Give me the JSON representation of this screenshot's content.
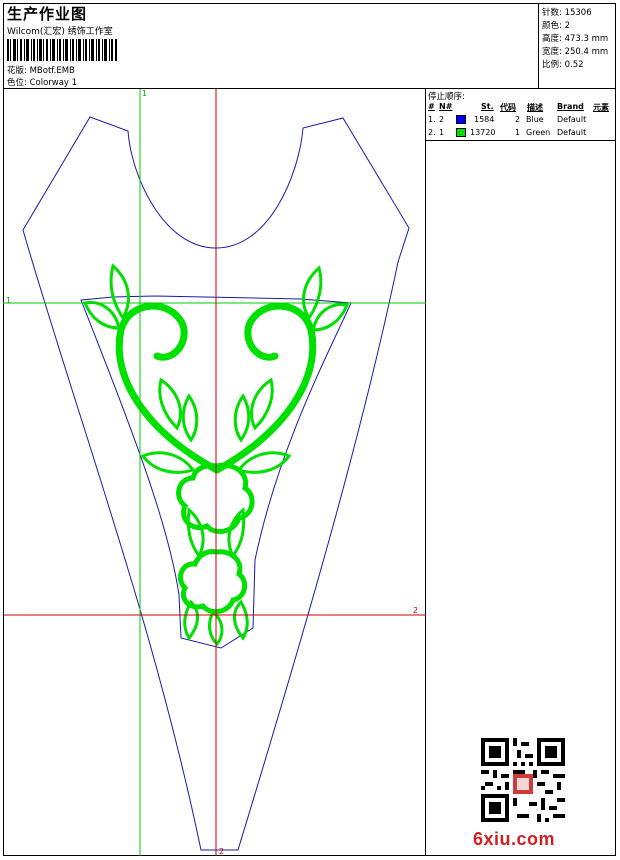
{
  "header": {
    "title": "生产作业图",
    "studio": "Wilcom(汇宏) 绣饰工作室",
    "design_label": "花版:",
    "design_value": "MBotf.EMB",
    "colorway_label": "色位:",
    "colorway_value": "Colorway 1"
  },
  "stats": {
    "stitches_label": "针数:",
    "stitches_value": "15306",
    "colors_label": "颜色:",
    "colors_value": "2",
    "height_label": "高度:",
    "height_value": "473.3 mm",
    "width_label": "宽度:",
    "width_value": "250.4 mm",
    "scale_label": "比例:",
    "scale_value": "0.52"
  },
  "stop_sequence": {
    "title": "停止顺序:",
    "headers": [
      "#",
      "N#",
      "St.",
      "代码",
      "描述",
      "Brand",
      "元素"
    ],
    "rows": [
      {
        "index": "1.",
        "n": "2",
        "color": "#0000ff",
        "stitches": "1584",
        "code": "2",
        "desc": "Blue",
        "brand": "Default"
      },
      {
        "index": "2.",
        "n": "1",
        "color": "#00e000",
        "stitches": "13720",
        "code": "1",
        "desc": "Green",
        "brand": "Default"
      }
    ]
  },
  "axes": {
    "v1": "1",
    "h1": "1",
    "h2": "2",
    "v2": "2"
  },
  "colors": {
    "outline": "#1a1aa8",
    "fill": "#00e000",
    "guide_green": "#00cc00",
    "guide_red": "#cc0000"
  },
  "watermark": "6xiu.com"
}
